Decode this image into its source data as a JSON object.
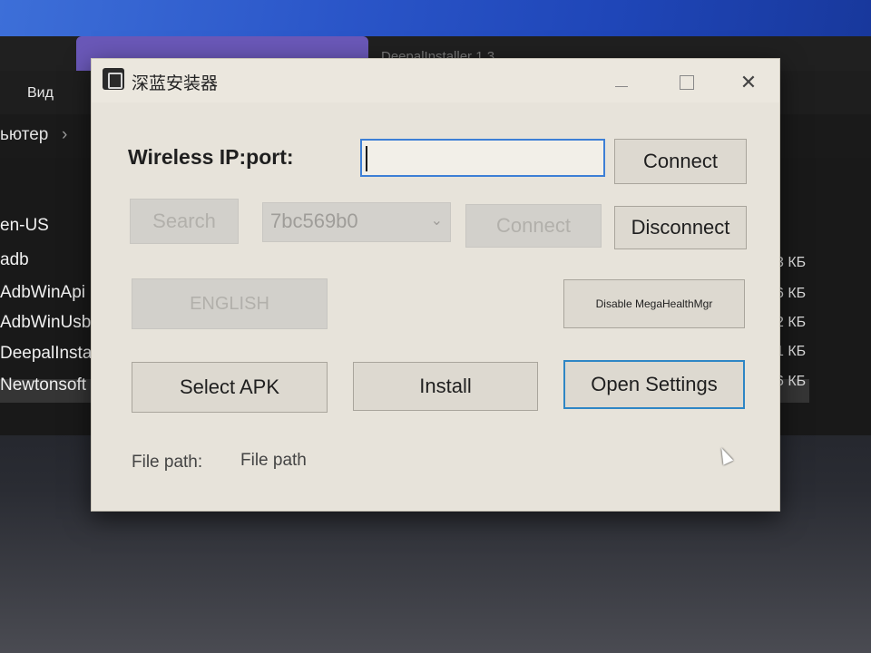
{
  "explorer": {
    "tab_title": "DeepalInstaller 1.3",
    "menu_view": "Вид",
    "breadcrumb": "ьютер",
    "files": [
      {
        "name": "en-US",
        "size": ""
      },
      {
        "name": "adb",
        "size": "3 КБ"
      },
      {
        "name": "AdbWinApi",
        "size": "6 КБ"
      },
      {
        "name": "AdbWinUsb",
        "size": "2 КБ"
      },
      {
        "name": "DeepalInsta",
        "size": "1 КБ"
      },
      {
        "name": "Newtonsoft",
        "size": "6 КБ"
      }
    ]
  },
  "app": {
    "title": "深蓝安装器",
    "wireless_label": "Wireless IP:port:",
    "ip_value": "",
    "connect_wireless": "Connect",
    "search": "Search",
    "device_selected": "7bc569b0",
    "connect_usb": "Connect",
    "disconnect": "Disconnect",
    "english": "ENGLISH",
    "disable_mega": "Disable MegaHealthMgr",
    "select_apk": "Select APK",
    "install": "Install",
    "open_settings": "Open Settings",
    "file_path_label": "File path:",
    "file_path_value": "File path"
  },
  "colors": {
    "focus_border": "#2e86c5",
    "input_focus": "#3d7fd6",
    "window_bg": "#e7e3da"
  }
}
